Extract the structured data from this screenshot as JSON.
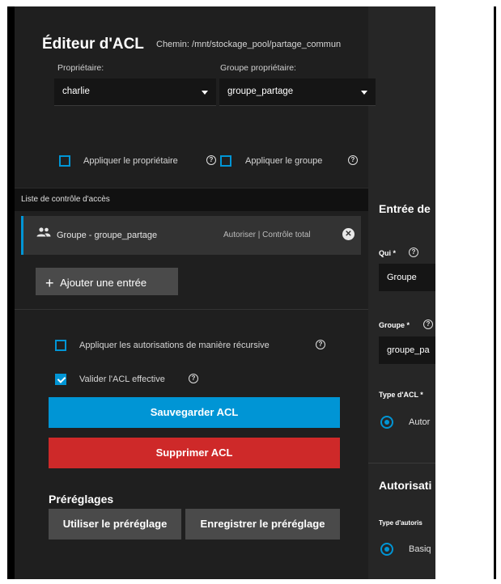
{
  "editor": {
    "title": "Éditeur d'ACL",
    "path": "Chemin: /mnt/stockage_pool/partage_commun",
    "owner_label": "Propriétaire:",
    "owner_value": "charlie",
    "group_label": "Groupe propriétaire:",
    "group_value": "groupe_partage",
    "apply_owner": "Appliquer le propriétaire",
    "apply_group": "Appliquer le groupe"
  },
  "acl_list": {
    "heading": "Liste de contrôle d'accès",
    "entries": [
      {
        "name": "Groupe - groupe_partage",
        "permission": "Autoriser | Contrôle total"
      }
    ],
    "add_entry": "Ajouter une entrée"
  },
  "options": {
    "recursive": "Appliquer les autorisations de manière récursive",
    "recursive_checked": false,
    "validate": "Valider l'ACL effective",
    "validate_checked": true,
    "save": "Sauvegarder ACL",
    "delete": "Supprimer ACL"
  },
  "presets": {
    "title": "Préréglages",
    "use": "Utiliser le préréglage",
    "save": "Enregistrer le préréglage"
  },
  "entry_panel": {
    "title": "Entrée de",
    "who_label": "Qui *",
    "who_value": "Groupe",
    "group_label": "Groupe *",
    "group_value": "groupe_pa",
    "acl_type_label": "Type d'ACL *",
    "acl_type_value": "Autor",
    "perm_title": "Autorisati",
    "perm_type_label": "Type d'autoris",
    "perm_type_value": "Basiq"
  },
  "colors": {
    "accent": "#0095d5",
    "danger": "#ce2929",
    "panel": "#1f1f1f"
  },
  "icons": [
    "people-icon",
    "close-icon",
    "plus-icon",
    "help-icon",
    "chevron-down-icon"
  ]
}
